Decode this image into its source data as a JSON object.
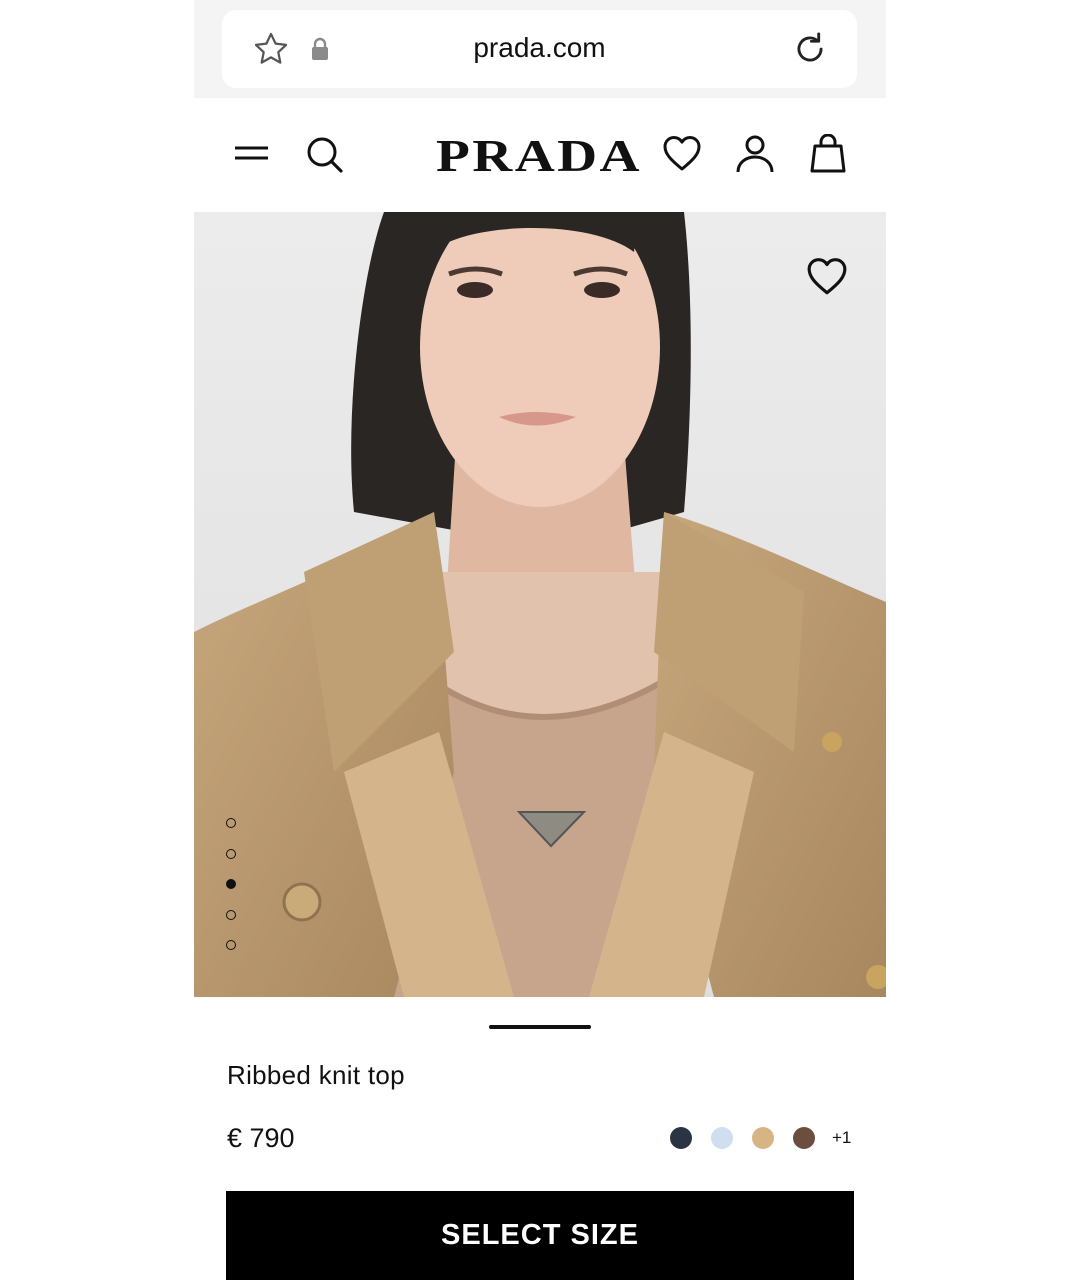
{
  "browser": {
    "url": "prada.com",
    "icons": [
      "star-icon",
      "lock-icon",
      "reload-icon"
    ]
  },
  "header": {
    "brand": "PRADA",
    "icons": [
      "menu-icon",
      "search-icon",
      "wishlist-icon",
      "account-icon",
      "bag-icon"
    ]
  },
  "gallery": {
    "image_count": 5,
    "active_index": 3
  },
  "product": {
    "title": "Ribbed knit top",
    "price": "€ 790",
    "color_swatches": [
      "#2b3444",
      "#cfdff0",
      "#d7b483",
      "#6b4e3e"
    ],
    "more_colors": "+1",
    "cta": "SELECT SIZE"
  }
}
